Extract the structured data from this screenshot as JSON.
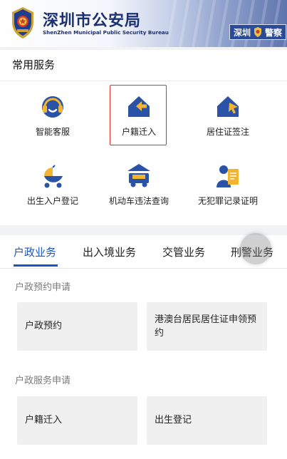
{
  "header": {
    "title": "深圳市公安局",
    "subtitle": "ShenZhen Municipal Public Security Bureau",
    "sign_text": "深圳",
    "sign_text2": "警察"
  },
  "common_services": {
    "title": "常用服务",
    "items": [
      {
        "label": "智能客服",
        "icon": "headset-icon"
      },
      {
        "label": "户籍迁入",
        "icon": "house-arrow-icon"
      },
      {
        "label": "居住证签注",
        "icon": "house-cursor-icon"
      },
      {
        "label": "出生入户登记",
        "icon": "baby-stroller-icon"
      },
      {
        "label": "机动车违法查询",
        "icon": "car-icon"
      },
      {
        "label": "无犯罪记录证明",
        "icon": "certificate-icon"
      }
    ]
  },
  "tabs": [
    {
      "label": "户政业务",
      "active": true
    },
    {
      "label": "出入境业务",
      "active": false
    },
    {
      "label": "交管业务",
      "active": false
    },
    {
      "label": "刑警业务",
      "active": false
    }
  ],
  "sections": [
    {
      "label": "户政预约申请",
      "tiles": [
        "户政预约",
        "港澳台居民居住证申领预约"
      ]
    },
    {
      "label": "户政服务申请",
      "tiles": [
        "户籍迁入",
        "出生登记"
      ]
    }
  ],
  "colors": {
    "brand_dark": "#1b2f73",
    "icon_blue": "#2a53a8",
    "icon_accent": "#f2b531",
    "active_tab": "#1d56c0",
    "highlight_frame": "#e0302a"
  }
}
